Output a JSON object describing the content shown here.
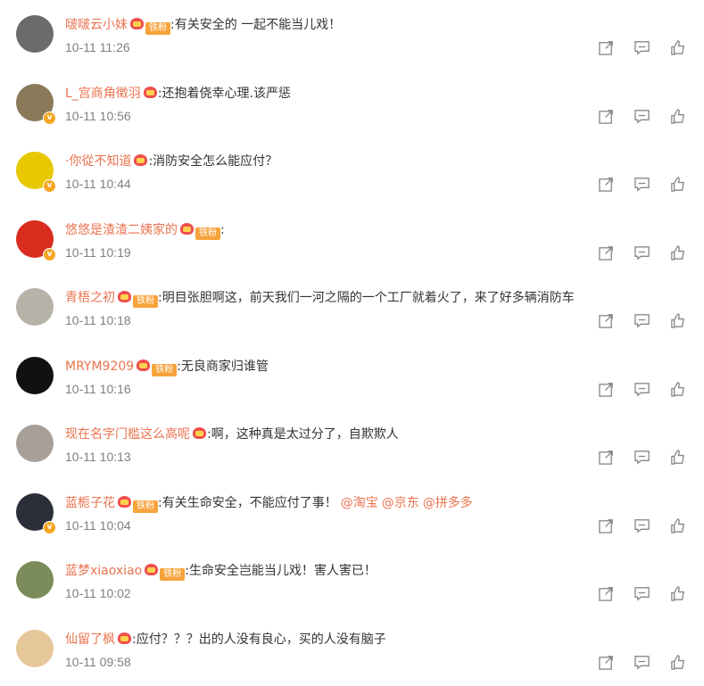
{
  "fan_badge_label": "铁粉",
  "comments": [
    {
      "username": "啵啵云小妹",
      "fan": true,
      "crown": true,
      "text": "有关安全的 一起不能当儿戏！",
      "time": "10-11 11:26",
      "verified": false,
      "avatar_color": "#6b6b6b"
    },
    {
      "username": "L_宫商角徵羽",
      "fan": false,
      "crown": true,
      "text": "还抱着侥幸心理.该严惩",
      "time": "10-11 10:56",
      "verified": true,
      "avatar_color": "#8a7a5a"
    },
    {
      "username": "·你從不知道",
      "fan": false,
      "crown": true,
      "text": "消防安全怎么能应付？",
      "time": "10-11 10:44",
      "verified": true,
      "avatar_color": "#e8c800"
    },
    {
      "username": "悠悠是渣渣二姨家的",
      "fan": true,
      "crown": true,
      "text": "",
      "time": "10-11 10:19",
      "verified": true,
      "avatar_color": "#d92d20"
    },
    {
      "username": "青梧之初",
      "fan": true,
      "crown": true,
      "text": "明目张胆啊这，前天我们一河之隔的一个工厂就着火了，来了好多辆消防车",
      "time": "10-11 10:18",
      "verified": false,
      "avatar_color": "#b7b2a8"
    },
    {
      "username": "MRYM9209",
      "fan": true,
      "crown": true,
      "text": "无良商家归谁管",
      "time": "10-11 10:16",
      "verified": false,
      "avatar_color": "#111111"
    },
    {
      "username": "现在名字门槛这么高呢",
      "fan": false,
      "crown": true,
      "text": "啊，这种真是太过分了，自欺欺人",
      "time": "10-11 10:13",
      "verified": false,
      "avatar_color": "#a8a098"
    },
    {
      "username": "蓝栀子花",
      "fan": true,
      "crown": true,
      "text": "有关生命安全，不能应付了事！",
      "mentions": [
        "@淘宝",
        "@京东",
        "@拼多多"
      ],
      "time": "10-11 10:04",
      "verified": true,
      "avatar_color": "#2b2f3a"
    },
    {
      "username": "蓝梦xiaoxiao",
      "fan": true,
      "crown": true,
      "text": "生命安全岂能当儿戏！害人害已！",
      "time": "10-11 10:02",
      "verified": false,
      "avatar_color": "#7b8b5a"
    },
    {
      "username": "仙留了枫",
      "fan": false,
      "crown": true,
      "text": "应付？？？出的人没有良心，买的人没有脑子",
      "time": "10-11 09:58",
      "verified": false,
      "avatar_color": "#e6c79a"
    }
  ]
}
